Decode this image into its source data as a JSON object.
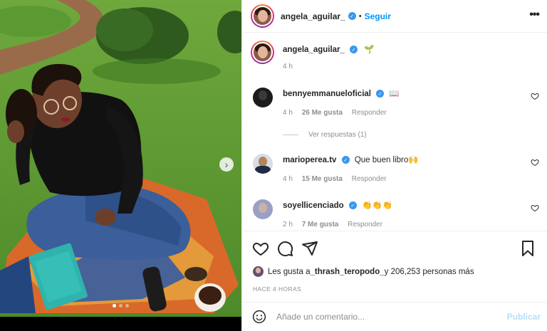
{
  "post": {
    "author": "angela_aguilar_",
    "dot": "•",
    "follow_label": "Seguir",
    "more_glyph": "•••",
    "caption_emoji": "🌱",
    "caption_time": "4 h"
  },
  "comments": [
    {
      "user": "bennyemmanueloficial",
      "text": "📖",
      "time": "4 h",
      "likes": "26 Me gusta",
      "reply_label": "Responder",
      "view_replies": "Ver respuestas (1)"
    },
    {
      "user": "marioperea.tv",
      "text": "Que buen libro🙌",
      "time": "4 h",
      "likes": "15 Me gusta",
      "reply_label": "Responder"
    },
    {
      "user": "soyellicenciado",
      "text": "👏👏👏",
      "time": "2 h",
      "likes": "7 Me gusta",
      "reply_label": "Responder"
    }
  ],
  "likes_summary": {
    "prefix": "Les gusta a ",
    "user": "_thrash_teropodo_",
    "suffix": " y 206,253 personas más"
  },
  "time_ago": "HACE 4 HORAS",
  "composer": {
    "placeholder": "Añade un comentario...",
    "emoji_icon": "smiley-icon",
    "publish_label": "Publicar"
  },
  "carousel": {
    "next_glyph": "›",
    "slides": 3,
    "active_index": 0
  },
  "colors": {
    "link_blue": "#0095f6",
    "publish_disabled": "#b2dffc",
    "verified_blue": "#3897f0",
    "meta_gray": "#8e8e8e"
  }
}
